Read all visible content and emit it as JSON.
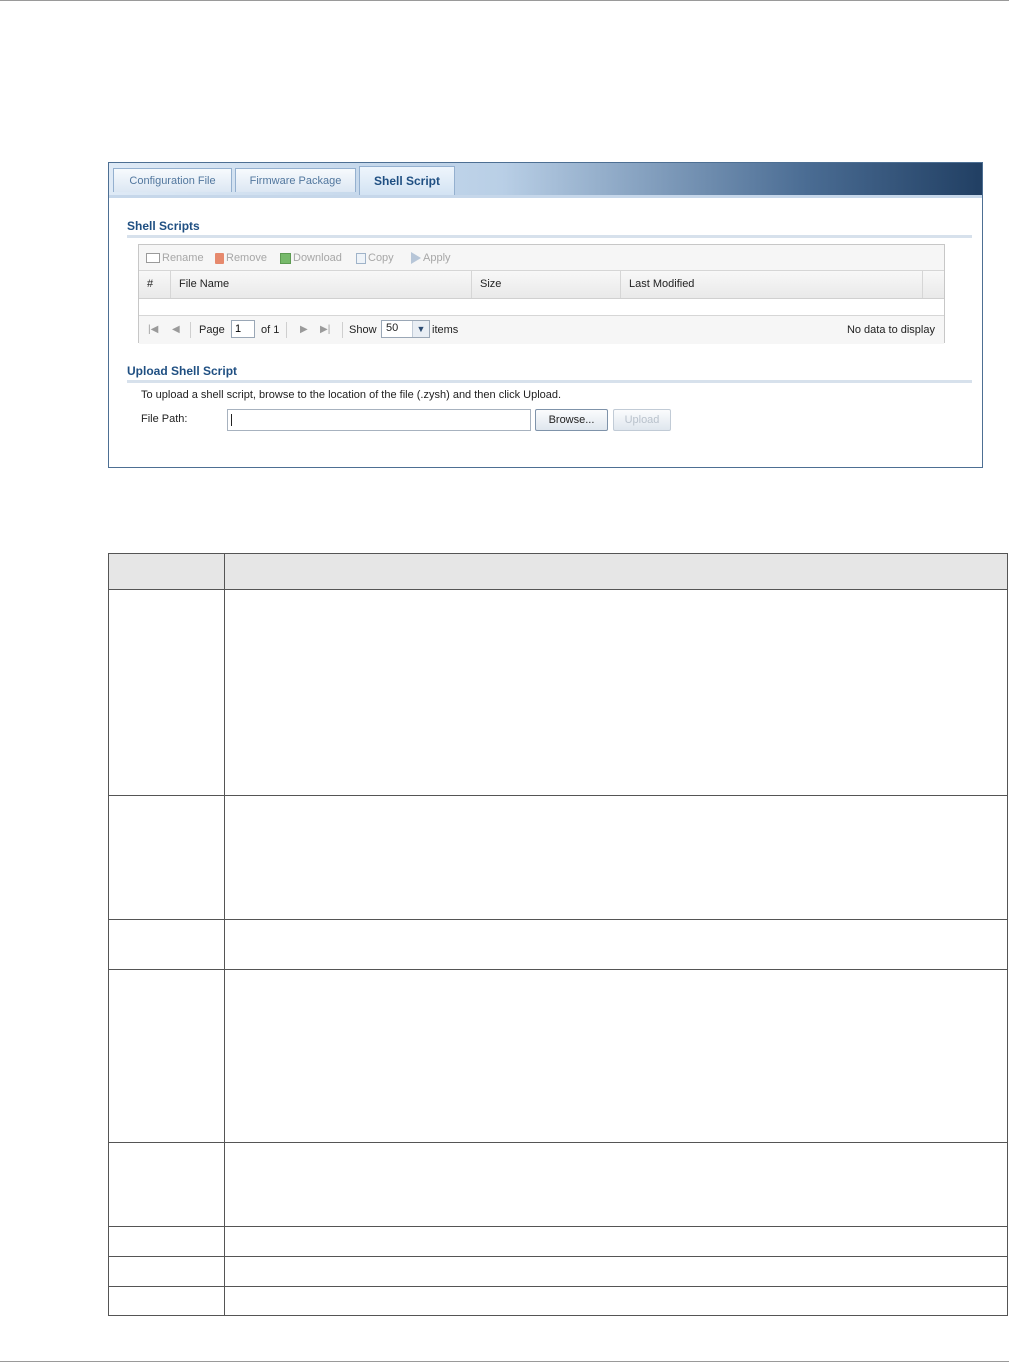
{
  "tabs": [
    {
      "label": "Configuration File",
      "active": false
    },
    {
      "label": "Firmware Package",
      "active": false
    },
    {
      "label": "Shell Script",
      "active": true
    }
  ],
  "shell_scripts": {
    "title": "Shell Scripts",
    "toolbar": {
      "rename": "Rename",
      "remove": "Remove",
      "download": "Download",
      "copy": "Copy",
      "apply": "Apply"
    },
    "columns": [
      "#",
      "File Name",
      "Size",
      "Last Modified"
    ],
    "rows": [],
    "pager": {
      "page_label": "Page",
      "page_value": "1",
      "of_label": "of 1",
      "show_label": "Show",
      "show_value": "50",
      "items_label": "items",
      "empty_text": "No data to display"
    }
  },
  "upload": {
    "title": "Upload Shell Script",
    "description": "To upload a shell script, browse to the location of the file (.zysh) and then click Upload.",
    "file_path_label": "File Path:",
    "file_path_value": "",
    "browse_label": "Browse...",
    "upload_label": "Upload"
  },
  "colors": {
    "tab_active_text": "#1f4f82",
    "section_title": "#1f4f82",
    "panel_border": "#4d6f93"
  }
}
